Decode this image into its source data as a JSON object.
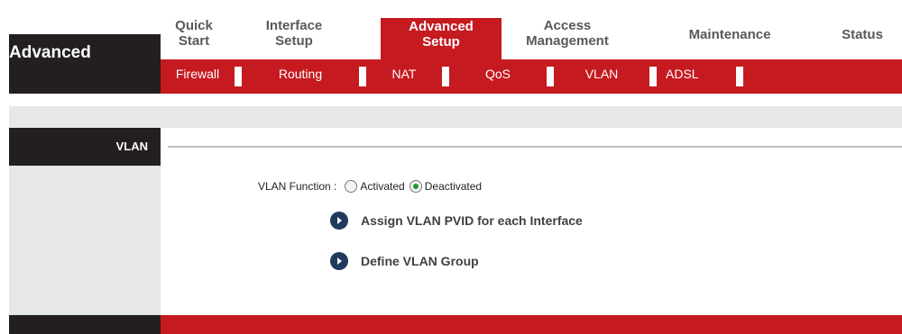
{
  "brand": {
    "title": "Advanced"
  },
  "topnav": {
    "tabs": [
      {
        "line1": "Quick",
        "line2": "Start"
      },
      {
        "line1": "Interface",
        "line2": "Setup"
      },
      {
        "line1": "Advanced",
        "line2": "Setup",
        "active": true
      },
      {
        "line1": "Access",
        "line2": "Management"
      },
      {
        "line1": "Maintenance",
        "line2": ""
      },
      {
        "line1": "Status",
        "line2": ""
      }
    ]
  },
  "subnav": {
    "items": [
      "Firewall",
      "Routing",
      "NAT",
      "QoS",
      "VLAN",
      "ADSL"
    ]
  },
  "section": {
    "label": "VLAN"
  },
  "vlan_function": {
    "label": "VLAN Function :",
    "options": [
      "Activated",
      "Deactivated"
    ],
    "selected": "Deactivated"
  },
  "links": {
    "assign_pvid": "Assign VLAN PVID for each Interface",
    "define_group": "Define VLAN Group"
  },
  "colors": {
    "accent_red": "#c51a20",
    "dark": "#231f20",
    "light_gray": "#e6e7e8",
    "radio_green": "#1f9a2e",
    "bullet_navy": "#1f3a5c"
  }
}
